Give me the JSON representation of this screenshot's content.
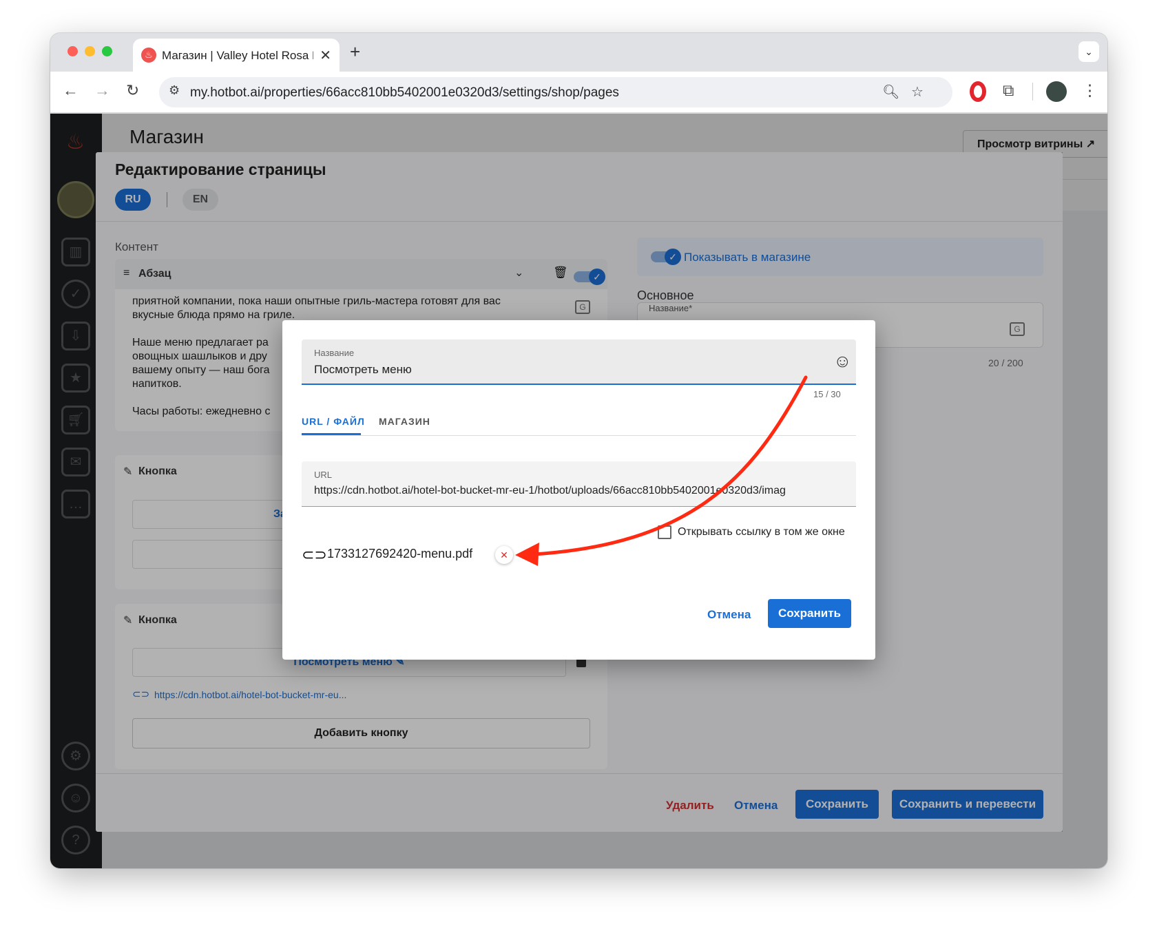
{
  "browser": {
    "tab_title": "Магазин | Valley Hotel Rosa K",
    "url": "my.hotbot.ai/properties/66acc810bb5402001e0320d3/settings/shop/pages"
  },
  "page": {
    "title": "Магазин",
    "storefront_button": "Просмотр витрины"
  },
  "editor": {
    "title": "Редактирование страницы",
    "lang_ru": "RU",
    "lang_en": "EN",
    "content_label": "Контент",
    "paragraph_block": {
      "label": "Абзац",
      "lines": [
        "приятной компании, пока наши опытные гриль-мастера готовят для вас",
        "вкусные блюда прямо на гриле.",
        "Наше меню предлагает ра",
        "овощных шашлыков и дру",
        "вашему опыту — наш бога",
        "напитков.",
        "Часы работы: ежедневно с"
      ]
    },
    "button_block_1": {
      "label": "Кнопка",
      "fragment": "За"
    },
    "button_block_2": {
      "label": "Кнопка",
      "button_text": "Посмотреть меню",
      "link": "https://cdn.hotbot.ai/hotel-bot-bucket-mr-eu..."
    },
    "add_button": "Добавить кнопку",
    "show_in_shop": "Показывать в магазине",
    "basic_label": "Основное",
    "name_label": "Название*",
    "name_counter": "20 / 200",
    "footer": {
      "delete": "Удалить",
      "cancel": "Отмена",
      "save": "Сохранить",
      "save_translate": "Сохранить и перевести"
    }
  },
  "dialog": {
    "name_label": "Название",
    "name_value": "Посмотреть меню",
    "counter": "15 / 30",
    "tabs": [
      "URL / ФАЙЛ",
      "МАГАЗИН"
    ],
    "url_label": "URL",
    "url_value": "https://cdn.hotbot.ai/hotel-bot-bucket-mr-eu-1/hotbot/uploads/66acc810bb5402001e0320d3/imag",
    "open_same_window": "Открывать ссылку в том же окне",
    "file_name": "1733127692420-menu.pdf",
    "cancel": "Отмена",
    "save": "Сохранить"
  },
  "colors": {
    "accent": "#1a6fd6",
    "danger": "#d32f2f",
    "annotation": "#ff2a12"
  }
}
